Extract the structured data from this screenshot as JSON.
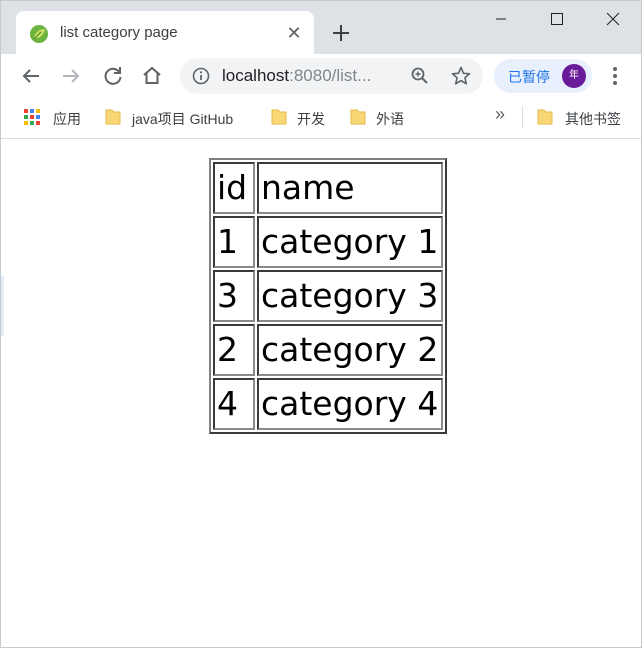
{
  "tab": {
    "title": "list category page"
  },
  "omnibox": {
    "url_host": "localhost",
    "url_rest": ":8080/list..."
  },
  "profile": {
    "paused_label": "已暂停",
    "avatar_initial": "年"
  },
  "bookmarks": {
    "apps_label": "应用",
    "items": [
      {
        "label": "java项目 GitHub"
      },
      {
        "label": "开发"
      },
      {
        "label": "外语"
      }
    ],
    "overflow_label": "»",
    "other_label": "其他书签"
  },
  "table": {
    "headers": [
      "id",
      "name"
    ],
    "rows": [
      {
        "id": "1",
        "name": "category 1"
      },
      {
        "id": "3",
        "name": "category 3"
      },
      {
        "id": "2",
        "name": "category 2"
      },
      {
        "id": "4",
        "name": "category 4"
      }
    ]
  },
  "colors": {
    "tabstrip_bg": "#dee1e6",
    "accent": "#1a73e8",
    "avatar_bg": "#6a1b9a",
    "folder": "#f8d775"
  }
}
